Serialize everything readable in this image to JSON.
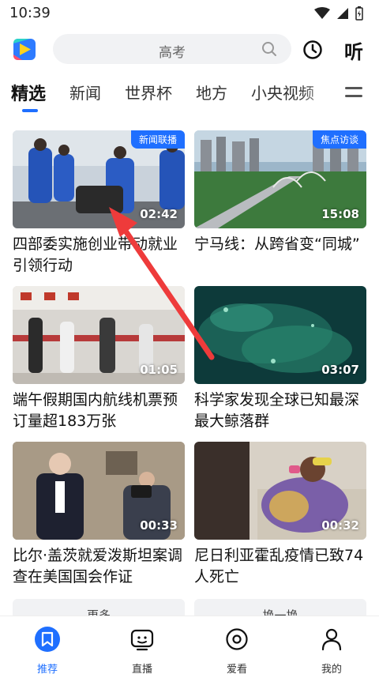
{
  "status_bar": {
    "time": "10:39"
  },
  "top_bar": {
    "search_placeholder": "高考",
    "listen_label": "听"
  },
  "tabs": [
    {
      "label": "精选",
      "active": true
    },
    {
      "label": "新闻"
    },
    {
      "label": "世界杯"
    },
    {
      "label": "地方"
    },
    {
      "label": "小央视频"
    }
  ],
  "cards": [
    {
      "badge": "新闻联播",
      "duration": "02:42",
      "title": "四部委实施创业带动就业引领行动"
    },
    {
      "badge": "焦点访谈",
      "duration": "15:08",
      "title": "宁马线：从跨省变“同城”"
    },
    {
      "badge": "",
      "duration": "01:05",
      "title": "端午假期国内航线机票预订量超183万张"
    },
    {
      "badge": "",
      "duration": "03:07",
      "title": "科学家发现全球已知最深最大鲸落群"
    },
    {
      "badge": "",
      "duration": "00:33",
      "title": "比尔·盖茨就爱泼斯坦案调查在美国国会作证"
    },
    {
      "badge": "",
      "duration": "00:32",
      "title": "尼日利亚霍乱疫情已致74人死亡"
    }
  ],
  "more_buttons": {
    "left": "更多",
    "right": "换一换"
  },
  "bottom_nav": [
    {
      "label": "推荐",
      "icon": "bookmark-icon",
      "active": true
    },
    {
      "label": "直播",
      "icon": "tv-face-icon"
    },
    {
      "label": "爱看",
      "icon": "target-icon"
    },
    {
      "label": "我的",
      "icon": "person-icon"
    }
  ],
  "colors": {
    "accent": "#1f6fff",
    "arrow": "#ee3b3b"
  }
}
